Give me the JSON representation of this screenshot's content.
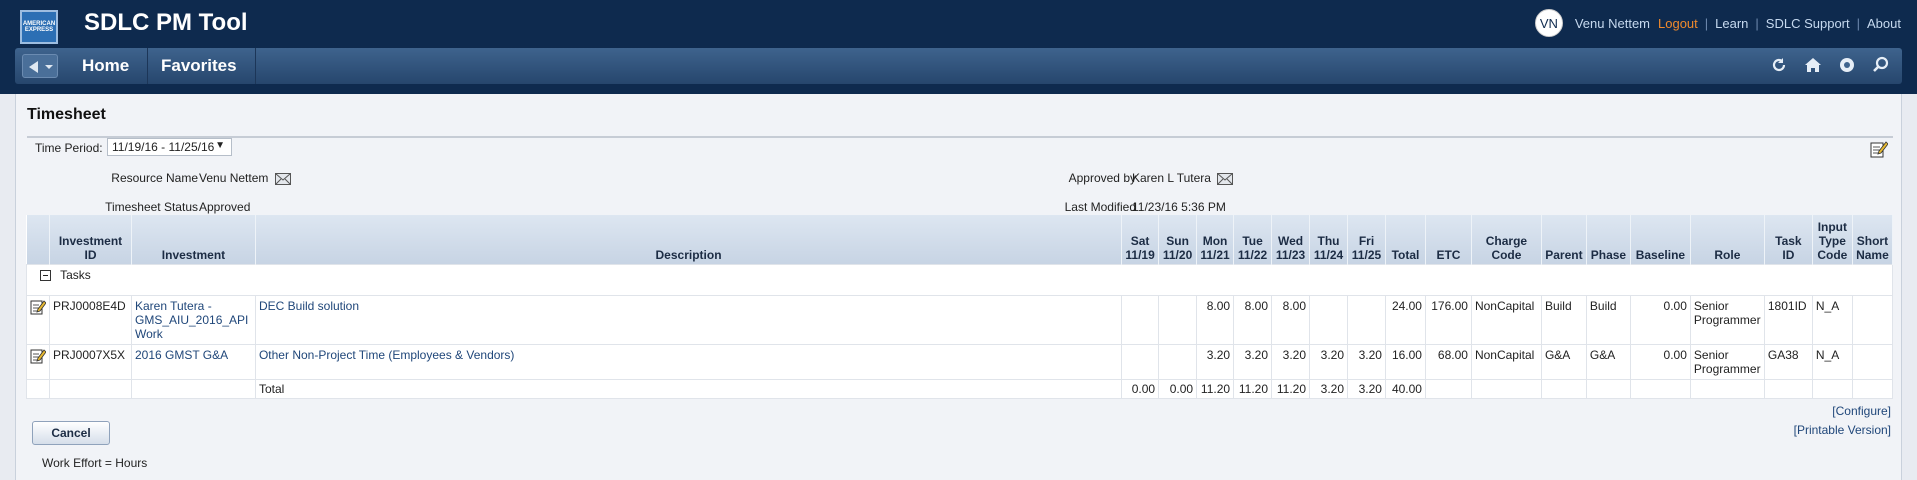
{
  "app": {
    "title": "SDLC PM Tool",
    "logo_text": "AMERICAN EXPRESS"
  },
  "user": {
    "initials": "VN",
    "name": "Venu Nettem"
  },
  "top_links": {
    "logout": "Logout",
    "learn": "Learn",
    "support": "SDLC Support",
    "about": "About"
  },
  "nav": {
    "home": "Home",
    "favorites": "Favorites"
  },
  "nav_icons": [
    "refresh-icon",
    "home-icon",
    "help-icon",
    "search-icon"
  ],
  "page": {
    "title": "Timesheet"
  },
  "time_period": {
    "label": "Time Period:",
    "value": "11/19/16 - 11/25/16"
  },
  "fields": {
    "resource_name_label": "Resource Name",
    "resource_name": "Venu Nettem",
    "status_label": "Timesheet Status",
    "status": "Approved",
    "approved_by_label": "Approved by",
    "approved_by": "Karen L Tutera",
    "last_modified_label": "Last Modified",
    "last_modified": "11/23/16 5:36 PM"
  },
  "grid": {
    "headers": {
      "investment_id": "Investment ID",
      "investment": "Investment",
      "description": "Description",
      "sat": "Sat 11/19",
      "sun": "Sun 11/20",
      "mon": "Mon 11/21",
      "tue": "Tue 11/22",
      "wed": "Wed 11/23",
      "thu": "Thu 11/24",
      "fri": "Fri 11/25",
      "total": "Total",
      "etc": "ETC",
      "charge_code": "Charge Code",
      "parent": "Parent",
      "phase": "Phase",
      "baseline": "Baseline",
      "role": "Role",
      "task_id": "Task ID",
      "input_type_code": "Input Type Code",
      "short_name": "Short Name"
    },
    "group_label": "Tasks",
    "rows": [
      {
        "investment_id": "PRJ0008E4D",
        "investment": "Karen Tutera - GMS_AIU_2016_API Work",
        "description": "DEC Build solution",
        "sat": "",
        "sun": "",
        "mon": "8.00",
        "tue": "8.00",
        "wed": "8.00",
        "thu": "",
        "fri": "",
        "total": "24.00",
        "etc": "176.00",
        "charge_code": "NonCapital",
        "parent": "Build",
        "phase": "Build",
        "baseline": "0.00",
        "role": "Senior Programmer",
        "task_id": "1801ID",
        "input_type_code": "N_A",
        "short_name": ""
      },
      {
        "investment_id": "PRJ0007X5X",
        "investment": "2016 GMST G&A",
        "description": "Other Non-Project Time (Employees & Vendors)",
        "sat": "",
        "sun": "",
        "mon": "3.20",
        "tue": "3.20",
        "wed": "3.20",
        "thu": "3.20",
        "fri": "3.20",
        "total": "16.00",
        "etc": "68.00",
        "charge_code": "NonCapital",
        "parent": "G&A",
        "phase": "G&A",
        "baseline": "0.00",
        "role": "Senior Programmer",
        "task_id": "GA38",
        "input_type_code": "N_A",
        "short_name": ""
      }
    ],
    "totals": {
      "label": "Total",
      "sat": "0.00",
      "sun": "0.00",
      "mon": "11.20",
      "tue": "11.20",
      "wed": "11.20",
      "thu": "3.20",
      "fri": "3.20",
      "total": "40.00"
    }
  },
  "links": {
    "configure": "[Configure]",
    "printable": "[Printable Version]"
  },
  "buttons": {
    "cancel": "Cancel"
  },
  "footer": {
    "work_effort": "Work Effort = Hours"
  }
}
